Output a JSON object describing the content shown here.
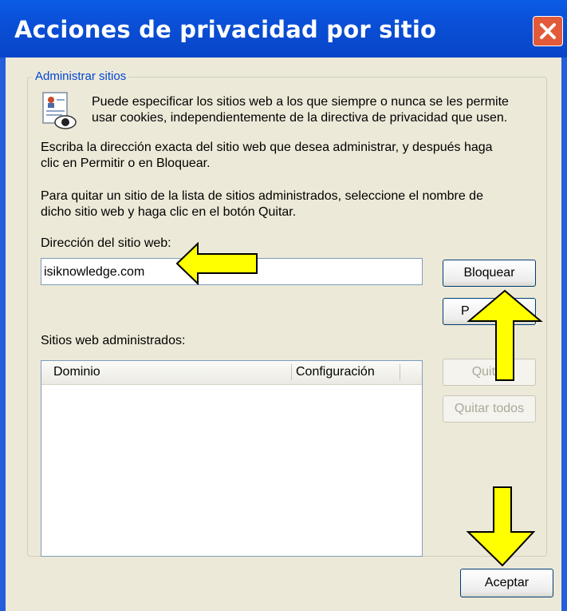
{
  "window": {
    "title": "Acciones de privacidad por sitio"
  },
  "group": {
    "legend": "Administrar sitios",
    "intro_line1": "Puede especificar los sitios web a los que siempre o nunca se les permite",
    "intro_line2": "usar cookies, independientemente de la directiva de privacidad que usen.",
    "instr1_line1": "Escriba la dirección exacta del sitio web que desea administrar, y después haga",
    "instr1_line2": "clic en Permitir o en Bloquear.",
    "instr2_line1": "Para quitar un sitio de la lista de sitios administrados, seleccione el nombre de",
    "instr2_line2": "dicho sitio web y haga clic en el botón Quitar.",
    "address_label": "Dirección del sitio web:",
    "address_value": "isiknowledge.com",
    "block_button": "Bloquear",
    "allow_button_visible": "P",
    "managed_label": "Sitios web administrados:",
    "columns": [
      "Dominio",
      "Configuración"
    ],
    "remove_button": "Quitar",
    "remove_all_button": "Quitar todos"
  },
  "footer": {
    "ok_button": "Aceptar"
  },
  "colors": {
    "titlebar": "#0a4fd6",
    "dialog_bg": "#ece9d8",
    "annotation_arrow": "#ffff00"
  },
  "icons": [
    "close-icon",
    "privacy-document-eye-icon",
    "annotation-arrow"
  ]
}
